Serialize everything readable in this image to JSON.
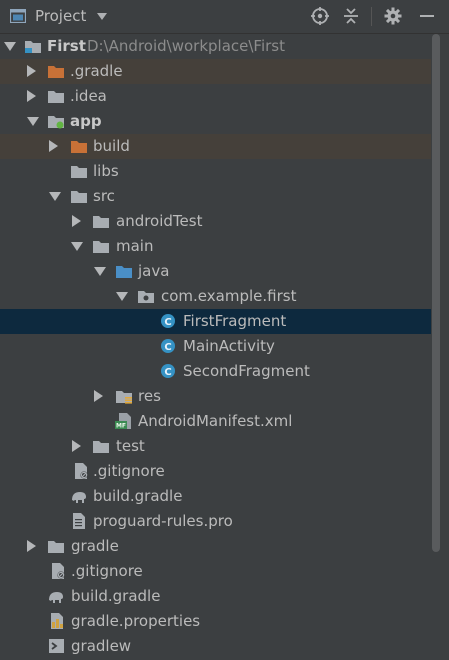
{
  "header": {
    "title": "Project"
  },
  "tree": [
    {
      "label": "First",
      "path": "D:\\Android\\workplace\\First"
    },
    {
      "label": ".gradle"
    },
    {
      "label": ".idea"
    },
    {
      "label": "app"
    },
    {
      "label": "build"
    },
    {
      "label": "libs"
    },
    {
      "label": "src"
    },
    {
      "label": "androidTest"
    },
    {
      "label": "main"
    },
    {
      "label": "java"
    },
    {
      "label": "com.example.first"
    },
    {
      "label": "FirstFragment"
    },
    {
      "label": "MainActivity"
    },
    {
      "label": "SecondFragment"
    },
    {
      "label": "res"
    },
    {
      "label": "AndroidManifest.xml"
    },
    {
      "label": "test"
    },
    {
      "label": ".gitignore"
    },
    {
      "label": "build.gradle"
    },
    {
      "label": "proguard-rules.pro"
    },
    {
      "label": "gradle"
    },
    {
      "label": ".gitignore"
    },
    {
      "label": "build.gradle"
    },
    {
      "label": "gradle.properties"
    },
    {
      "label": "gradlew"
    }
  ],
  "colors": {
    "background": "#3c3f41",
    "selected_row": "#0d293e",
    "excluded_row": "#45403a",
    "folder": "#a8adb2",
    "excluded_folder": "#c87137",
    "source_folder": "#4a8fc7",
    "class_icon": "#3592c4"
  }
}
